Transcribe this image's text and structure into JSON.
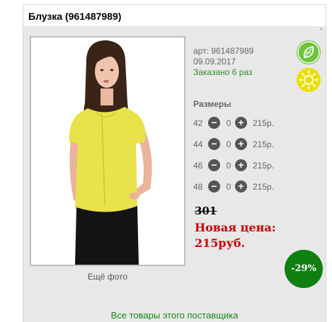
{
  "product": {
    "title": "Блузка (961487989)",
    "article": "арт: 961487989",
    "date": "09.09.2017",
    "ordered": "Заказано 6 раз"
  },
  "gallery": {
    "more_photos": "Ещё фото"
  },
  "sizes": {
    "label": "Размеры",
    "rows": [
      {
        "size": "42",
        "qty": "0",
        "price": "215р."
      },
      {
        "size": "44",
        "qty": "0",
        "price": "215р."
      },
      {
        "size": "46",
        "qty": "0",
        "price": "215р."
      },
      {
        "size": "48",
        "qty": "0",
        "price": "215р."
      }
    ]
  },
  "pricing": {
    "old_price": "301",
    "new_price_label": "Новая цена:",
    "new_price": "215руб.",
    "discount": "-29%"
  },
  "supplier_link": "Все товары этого поставщика",
  "badges": {
    "leaf": "leaf-icon",
    "sun": "sun-icon"
  },
  "colors": {
    "ordered": "#2e8b2e",
    "new_price": "#cc0000",
    "discount_bg": "#0f7f0f",
    "leaf_bg": "#6cc53c",
    "sun_bg": "#e8e000"
  }
}
